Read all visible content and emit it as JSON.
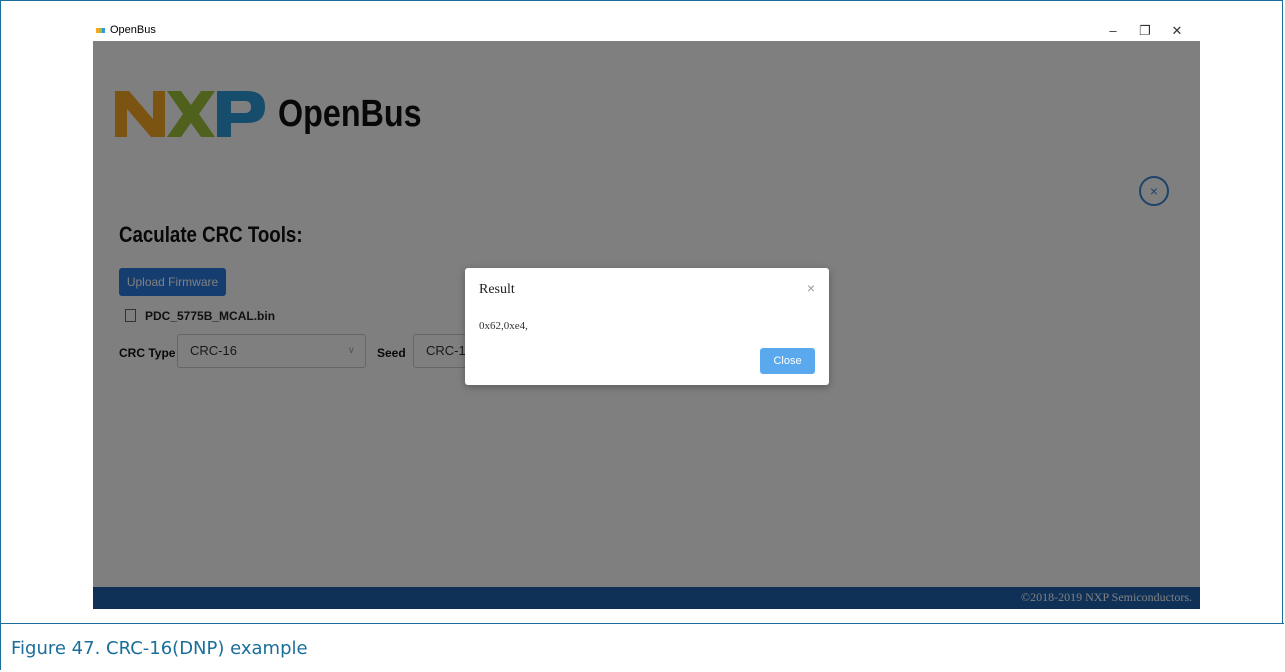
{
  "window": {
    "title": "OpenBus",
    "controls": {
      "minimize": "–",
      "restore": "❐",
      "close": "✕"
    }
  },
  "header": {
    "app_title": "OpenBus",
    "close_symbol": "×"
  },
  "main": {
    "section_title": "Caculate CRC Tools:",
    "upload_button": "Upload Firmware",
    "file_name": "PDC_5775B_MCAL.bin",
    "crc_type_label": "CRC Type",
    "crc_type_value": "CRC-16",
    "seed_label": "Seed",
    "seed_value": "CRC-1"
  },
  "footer": {
    "copyright": "©2018-2019 NXP Semiconductors."
  },
  "modal": {
    "title": "Result",
    "body": "0x62,0xe4,",
    "close_button": "Close",
    "close_symbol": "×"
  },
  "caption": {
    "text": "Figure 47.  CRC-16(DNP) example"
  },
  "colors": {
    "accent": "#2c7be0",
    "footer": "#1f62b0",
    "caption": "#1a6e9a"
  }
}
